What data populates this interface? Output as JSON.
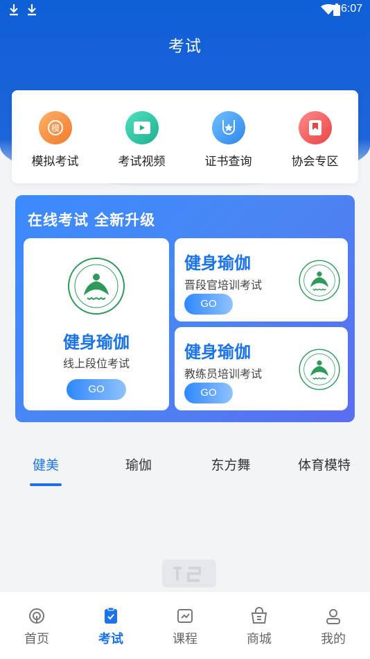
{
  "status_bar": {
    "time": "6:07"
  },
  "header": {
    "title": "考试"
  },
  "quick_menu": [
    {
      "label": "模拟考试",
      "icon": "mock-exam-icon",
      "color": "#f0923a"
    },
    {
      "label": "考试视频",
      "icon": "video-play-icon",
      "color": "#2ec4a5"
    },
    {
      "label": "证书查询",
      "icon": "certificate-icon",
      "color": "#3c9af5"
    },
    {
      "label": "协会专区",
      "icon": "bookmark-icon",
      "color": "#f05b5b"
    }
  ],
  "banner": {
    "title": "在线考试 全新升级",
    "cards": [
      {
        "title": "健身瑜伽",
        "subtitle": "线上段位考试",
        "button": "GO"
      },
      {
        "title": "健身瑜伽",
        "subtitle": "晋段官培训考试",
        "button": "GO"
      },
      {
        "title": "健身瑜伽",
        "subtitle": "教练员培训考试",
        "button": "GO"
      }
    ]
  },
  "tabs": [
    {
      "label": "健美",
      "active": true
    },
    {
      "label": "瑜伽",
      "active": false
    },
    {
      "label": "东方舞",
      "active": false
    },
    {
      "label": "体育模特",
      "active": false
    }
  ],
  "bottom_nav": [
    {
      "label": "首页",
      "icon": "home-icon",
      "active": false
    },
    {
      "label": "考试",
      "icon": "exam-icon",
      "active": true
    },
    {
      "label": "课程",
      "icon": "course-icon",
      "active": false
    },
    {
      "label": "商城",
      "icon": "shop-icon",
      "active": false
    },
    {
      "label": "我的",
      "icon": "profile-icon",
      "active": false
    }
  ],
  "colors": {
    "primary": "#1a73e8",
    "header_bg": "#1a63d9"
  }
}
